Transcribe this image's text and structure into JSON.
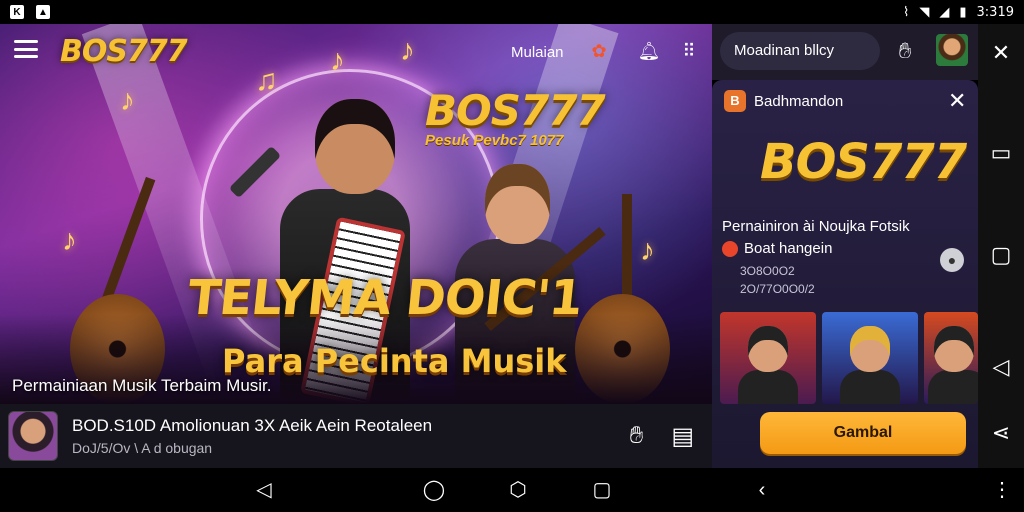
{
  "status_bar": {
    "time": "3:319",
    "icons": [
      "app-k-icon",
      "app-image-icon",
      "vibrate-icon",
      "wifi-icon",
      "signal-icon",
      "battery-icon"
    ]
  },
  "hero": {
    "logo": "BOS777",
    "top_link": "Mulaian",
    "brand_big": "BOS777",
    "brand_sub": "Pesuk Pevbc7 1077",
    "headline": "TELYMA DOIC'1",
    "subheadline": "Para Pecinta Musik",
    "caption": "Permainiaan Musik Terbaim Musir."
  },
  "app_bar": {
    "title": "BOD.S10D Amolionuan 3X Aeik Aein Reotaleen",
    "subtitle": "DoJ/5/Ov \\ A d obugan"
  },
  "right_top": {
    "search_text": "Moadinan  bllcy"
  },
  "panel": {
    "header": "Badhmandon",
    "logo": "BOS777",
    "description": "Pernainiron ài Noujka Fotsik",
    "developer": "Boat hangein",
    "meta_line_1": "3O8O0O2",
    "meta_line_2": "2O/77O0O0/2",
    "cta": "Gambal"
  },
  "colors": {
    "accent_gold": "#f6c233",
    "cta_orange": "#f49a15",
    "panel_bg": "#2a2246"
  }
}
